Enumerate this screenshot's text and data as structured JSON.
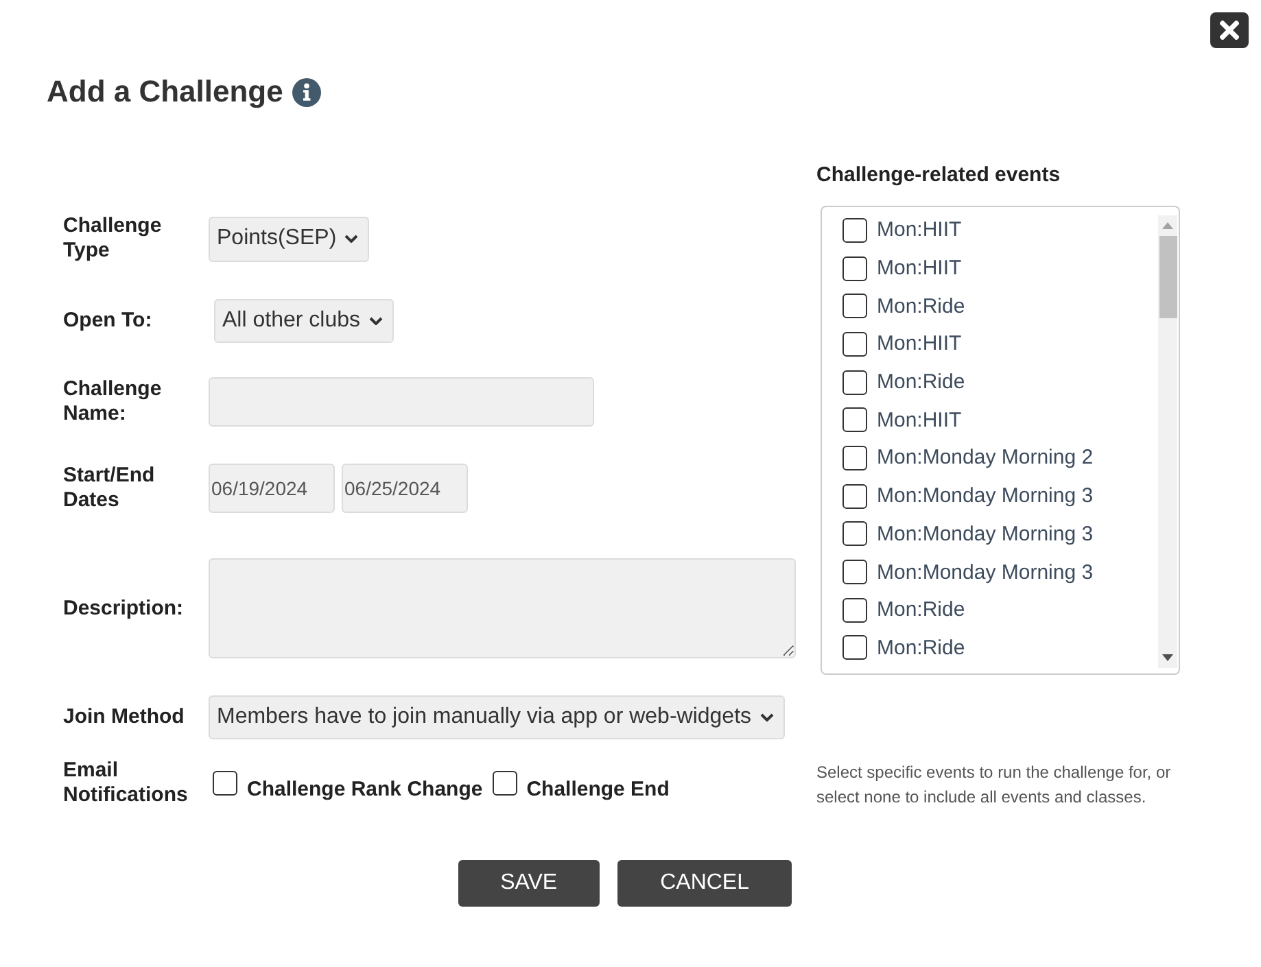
{
  "dialog": {
    "title": "Add a Challenge"
  },
  "form": {
    "fields": [
      {
        "kind": "select",
        "label": "Challenge Type",
        "value": "Points(SEP)"
      },
      {
        "kind": "select",
        "label": "Open To:",
        "value": "All other clubs"
      },
      {
        "kind": "text",
        "label": "Challenge Name:"
      },
      {
        "kind": "dates",
        "label": "Start/End Dates",
        "values": [
          "06/19/2024",
          "06/25/2024"
        ]
      },
      {
        "kind": "textarea",
        "label": "Description:"
      },
      {
        "kind": "select",
        "label": "Join Method",
        "value": "Members have to join manually via app or web-widgets"
      },
      {
        "kind": "checkboxes",
        "label": "Email Notifications",
        "options": [
          {
            "label": "Challenge Rank Change",
            "checked": false
          },
          {
            "label": "Challenge End",
            "checked": false
          }
        ]
      }
    ]
  },
  "buttons": [
    {
      "label": "SAVE"
    },
    {
      "label": "CANCEL"
    }
  ],
  "events": {
    "title": "Challenge-related events",
    "items": [
      {
        "label": "Mon:HIIT",
        "checked": false
      },
      {
        "label": "Mon:HIIT",
        "checked": false
      },
      {
        "label": "Mon:Ride",
        "checked": false
      },
      {
        "label": "Mon:HIIT",
        "checked": false
      },
      {
        "label": "Mon:Ride",
        "checked": false
      },
      {
        "label": "Mon:HIIT",
        "checked": false
      },
      {
        "label": "Mon:Monday Morning 2",
        "checked": false
      },
      {
        "label": "Mon:Monday Morning 3",
        "checked": false
      },
      {
        "label": "Mon:Monday Morning 3",
        "checked": false
      },
      {
        "label": "Mon:Monday Morning 3",
        "checked": false
      },
      {
        "label": "Mon:Ride",
        "checked": false
      },
      {
        "label": "Mon:Ride",
        "checked": false
      }
    ],
    "help": "Select specific events to run the challenge for, or select none to include all events and classes."
  }
}
